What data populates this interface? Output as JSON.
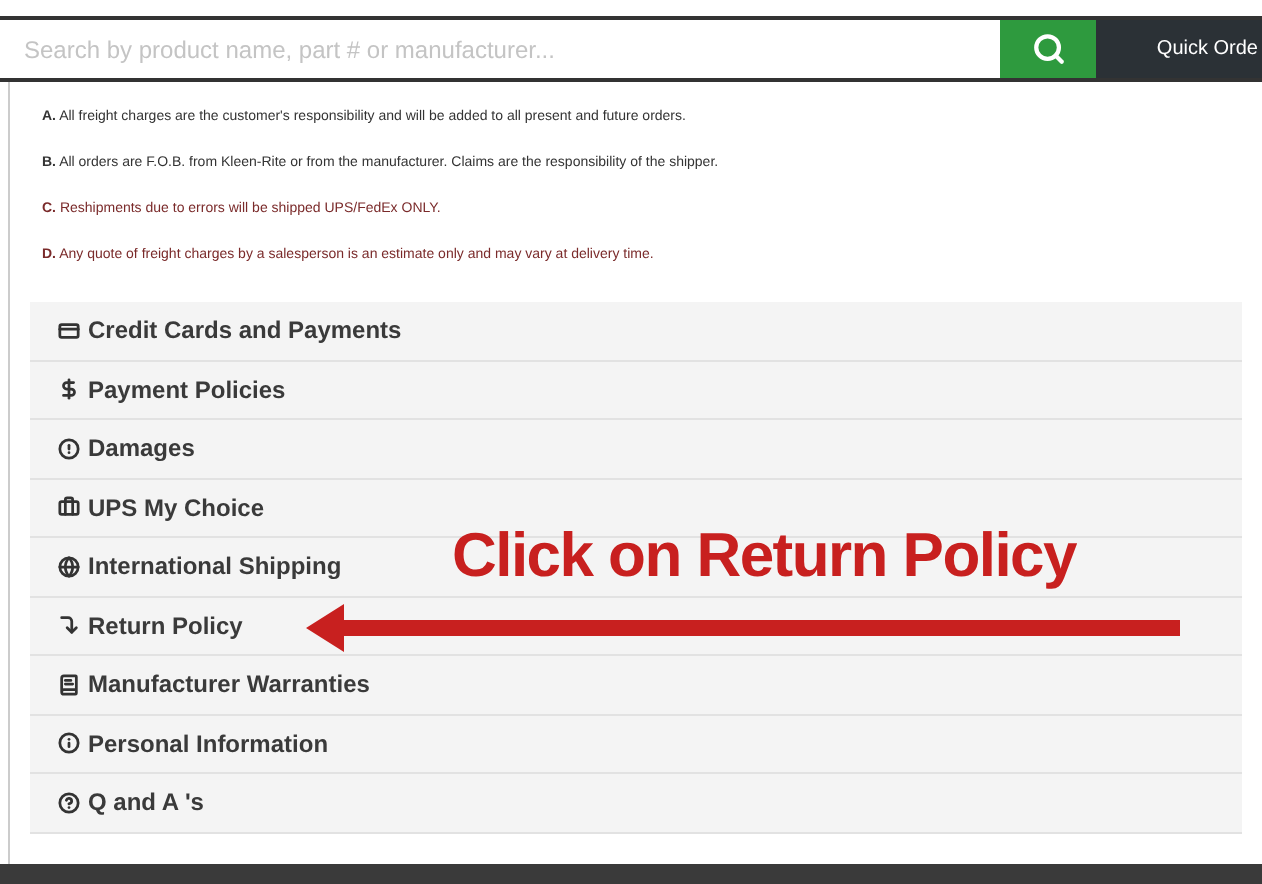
{
  "search": {
    "placeholder": "Search by product name, part # or manufacturer..."
  },
  "quick_order": "Quick Orde",
  "notes": [
    {
      "label": "A.",
      "text": "All freight charges are the customer's responsibility and will be added to all present and future orders."
    },
    {
      "label": "B.",
      "text": "All orders are F.O.B. from Kleen-Rite or from the manufacturer. Claims are the responsibility of the shipper."
    },
    {
      "label": "C.",
      "text": "Reshipments due to errors will be shipped UPS/FedEx ONLY."
    },
    {
      "label": "D.",
      "text": "Any quote of freight charges by a salesperson is an estimate only and may vary at delivery time."
    }
  ],
  "sections": [
    {
      "title": "Credit Cards and Payments"
    },
    {
      "title": "Payment Policies"
    },
    {
      "title": "Damages"
    },
    {
      "title": "UPS My Choice"
    },
    {
      "title": "International Shipping"
    },
    {
      "title": "Return Policy"
    },
    {
      "title": "Manufacturer Warranties"
    },
    {
      "title": "Personal Information"
    },
    {
      "title": "Q and A 's"
    }
  ],
  "annotation": {
    "text": "Click on Return Policy"
  }
}
